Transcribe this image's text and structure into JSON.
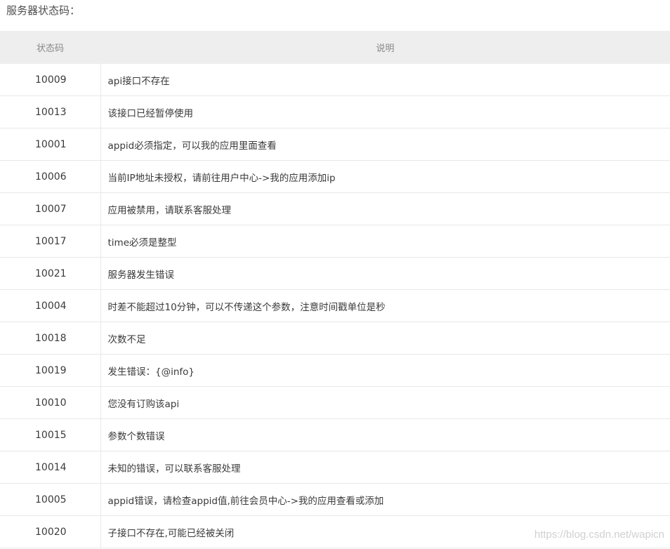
{
  "title": "服务器状态码：",
  "table": {
    "headers": [
      "状态码",
      "说明"
    ],
    "rows": [
      {
        "code": "10009",
        "desc": "api接口不存在"
      },
      {
        "code": "10013",
        "desc": "该接口已经暂停使用"
      },
      {
        "code": "10001",
        "desc": "appid必须指定，可以我的应用里面查看"
      },
      {
        "code": "10006",
        "desc": "当前IP地址未授权，请前往用户中心->我的应用添加ip"
      },
      {
        "code": "10007",
        "desc": "应用被禁用，请联系客服处理"
      },
      {
        "code": "10017",
        "desc": "time必须是整型"
      },
      {
        "code": "10021",
        "desc": "服务器发生错误"
      },
      {
        "code": "10004",
        "desc": "时差不能超过10分钟，可以不传递这个参数，注意时间戳单位是秒"
      },
      {
        "code": "10018",
        "desc": "次数不足"
      },
      {
        "code": "10019",
        "desc": "发生错误：{@info}"
      },
      {
        "code": "10010",
        "desc": "您没有订购该api"
      },
      {
        "code": "10015",
        "desc": "参数个数错误"
      },
      {
        "code": "10014",
        "desc": "未知的错误，可以联系客服处理"
      },
      {
        "code": "10005",
        "desc": "appid错误，请检查appid值,前往会员中心->我的应用查看或添加"
      },
      {
        "code": "10020",
        "desc": "子接口不存在,可能已经被关闭"
      }
    ]
  },
  "watermark": "https://blog.csdn.net/wapicn"
}
